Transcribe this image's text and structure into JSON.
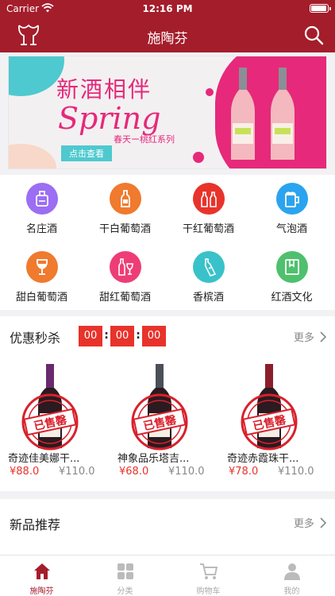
{
  "status_bar": {
    "carrier": "Carrier",
    "time": "12:16 PM"
  },
  "nav": {
    "title": "施陶芬",
    "logo_icon": "wine-glasses-icon",
    "search_icon": "search-icon"
  },
  "banner": {
    "headline": "新酒相伴",
    "spring": "Spring",
    "series": "春天ー桃红系列",
    "cta": "点击查看",
    "colors": {
      "pink": "#e6297a",
      "teal": "#4ec9cf"
    }
  },
  "categories": [
    {
      "label": "名庄酒",
      "icon": "bottle-box-icon",
      "color": "#9b6ef3"
    },
    {
      "label": "干白葡萄酒",
      "icon": "wine-bottle-icon",
      "color": "#f07a2d"
    },
    {
      "label": "干红葡萄酒",
      "icon": "two-bottles-icon",
      "color": "#e8332b"
    },
    {
      "label": "气泡酒",
      "icon": "beer-mug-icon",
      "color": "#2aa4ee"
    },
    {
      "label": "甜白葡萄酒",
      "icon": "wine-glass-icon",
      "color": "#f07a2d"
    },
    {
      "label": "甜红葡萄酒",
      "icon": "bottle-glass-icon",
      "color": "#ee3d76"
    },
    {
      "label": "香槟酒",
      "icon": "champagne-icon",
      "color": "#39c2c9"
    },
    {
      "label": "红酒文化",
      "icon": "book-icon",
      "color": "#4fc06d"
    }
  ],
  "flash_sale": {
    "title": "优惠秒杀",
    "more": "更多",
    "countdown": [
      "00",
      "00",
      "00"
    ],
    "products": [
      {
        "name": "奇迹佳美娜干...",
        "price": "¥88.0",
        "original_price": "¥110.0",
        "stamp": "已售罄"
      },
      {
        "name": "神象品乐塔吉...",
        "price": "¥68.0",
        "original_price": "¥110.0",
        "stamp": "已售罄"
      },
      {
        "name": "奇迹赤霞珠干...",
        "price": "¥78.0",
        "original_price": "¥110.0",
        "stamp": "已售罄"
      }
    ]
  },
  "new_products": {
    "title": "新品推荐",
    "more": "更多"
  },
  "tabbar": [
    {
      "label": "施陶芬",
      "icon": "home-icon",
      "active": true
    },
    {
      "label": "分类",
      "icon": "grid-icon",
      "active": false
    },
    {
      "label": "购物车",
      "icon": "cart-icon",
      "active": false
    },
    {
      "label": "我的",
      "icon": "person-icon",
      "active": false
    }
  ],
  "colors": {
    "brand": "#a41d2b",
    "accent_red": "#e8332b",
    "inactive": "#aaaaaa"
  }
}
